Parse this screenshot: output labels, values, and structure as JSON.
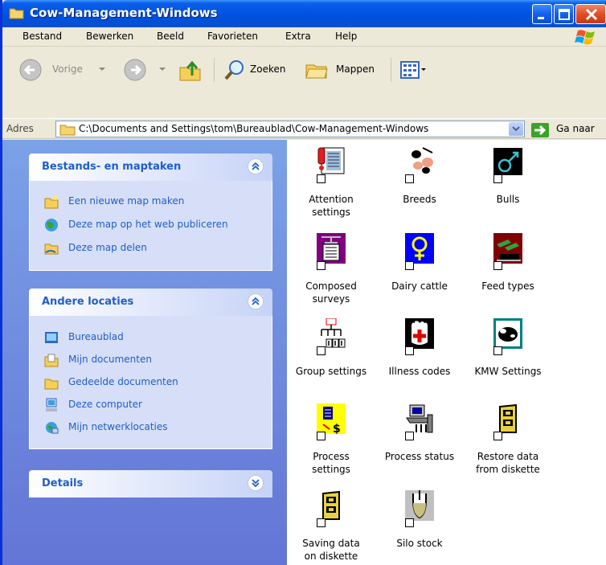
{
  "window": {
    "title": "Cow-Management-Windows"
  },
  "menu": [
    "Bestand",
    "Bewerken",
    "Beeld",
    "Favorieten",
    "Extra",
    "Help"
  ],
  "toolbar": {
    "back_label": "Vorige",
    "search_label": "Zoeken",
    "folders_label": "Mappen"
  },
  "address": {
    "label": "Adres",
    "value": "C:\\Documents and Settings\\tom\\Bureaublad\\Cow-Management-Windows",
    "go_label": "Ga naar"
  },
  "panels": {
    "file_tasks": {
      "title": "Bestands- en maptaken",
      "items": [
        "Een nieuwe map maken",
        "Deze map op het web publiceren",
        "Deze map delen"
      ]
    },
    "other_places": {
      "title": "Andere locaties",
      "items": [
        "Bureaublad",
        "Mijn documenten",
        "Gedeelde documenten",
        "Deze computer",
        "Mijn netwerklocaties"
      ]
    },
    "details": {
      "title": "Details"
    }
  },
  "items": [
    {
      "label": "Attention settings",
      "line1": "Attention",
      "line2": "settings",
      "icon": "attention-icon"
    },
    {
      "label": "Breeds",
      "line1": "Breeds",
      "line2": "",
      "icon": "breeds-icon"
    },
    {
      "label": "Bulls",
      "line1": "Bulls",
      "line2": "",
      "icon": "bulls-icon"
    },
    {
      "label": "Composed surveys",
      "line1": "Composed",
      "line2": "surveys",
      "icon": "composed-surveys-icon"
    },
    {
      "label": "Dairy cattle",
      "line1": "Dairy cattle",
      "line2": "",
      "icon": "dairy-cattle-icon"
    },
    {
      "label": "Feed types",
      "line1": "Feed types",
      "line2": "",
      "icon": "feed-types-icon"
    },
    {
      "label": "Group settings",
      "line1": "Group settings",
      "line2": "",
      "icon": "group-settings-icon"
    },
    {
      "label": "Illness codes",
      "line1": "Illness codes",
      "line2": "",
      "icon": "illness-codes-icon"
    },
    {
      "label": "KMW Settings",
      "line1": "KMW Settings",
      "line2": "",
      "icon": "kmw-settings-icon"
    },
    {
      "label": "Process settings",
      "line1": "Process",
      "line2": "settings",
      "icon": "process-settings-icon"
    },
    {
      "label": "Process status",
      "line1": "Process status",
      "line2": "",
      "icon": "process-status-icon"
    },
    {
      "label": "Restore data from diskette",
      "line1": "Restore data",
      "line2": "from diskette",
      "icon": "restore-data-icon"
    },
    {
      "label": "Saving data on diskette",
      "line1": "Saving data",
      "line2": "on diskette",
      "icon": "saving-data-icon"
    },
    {
      "label": "Silo stock",
      "line1": "Silo stock",
      "line2": "",
      "icon": "silo-stock-icon"
    }
  ]
}
